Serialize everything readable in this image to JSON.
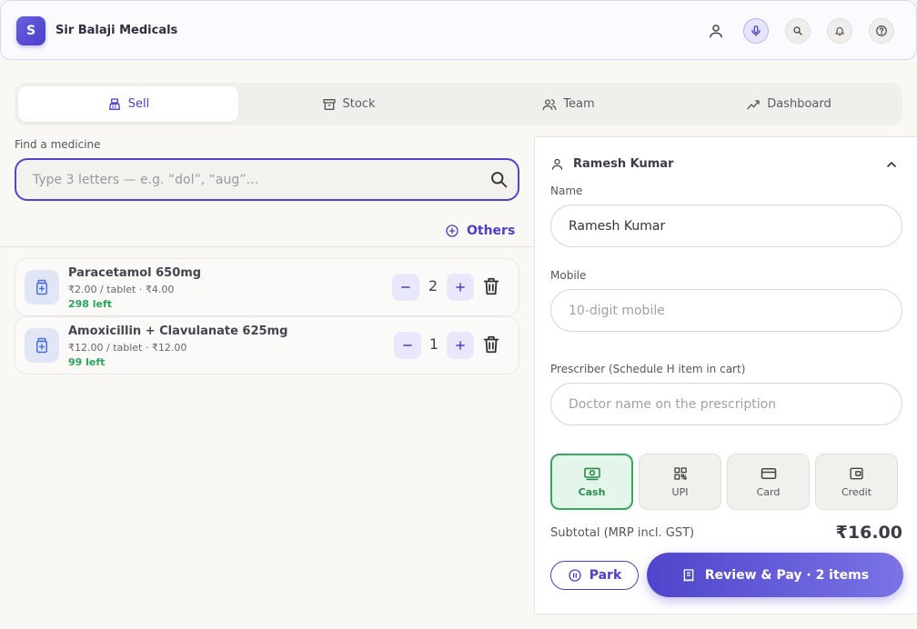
{
  "app": {
    "logo_letter": "S",
    "title": "Sir Balaji Medicals"
  },
  "header": {
    "icons": [
      "user-icon",
      "mic-icon",
      "search-icon",
      "bell-icon",
      "help-icon"
    ]
  },
  "tabs": [
    {
      "label": "Sell",
      "icon": "pos-icon",
      "active": true
    },
    {
      "label": "Stock",
      "icon": "box-icon",
      "active": false
    },
    {
      "label": "Team",
      "icon": "users-icon",
      "active": false
    },
    {
      "label": "Dashboard",
      "icon": "trend-icon",
      "active": false
    }
  ],
  "search": {
    "label": "Find a medicine",
    "placeholder": "Type 3 letters — e.g. “dol”, “aug”…",
    "value": ""
  },
  "others_label": "Others",
  "cart": [
    {
      "name": "Paracetamol 650mg",
      "price_line": "₹2.00 / tablet · ₹4.00",
      "stock": "298 left",
      "qty": "2"
    },
    {
      "name": "Amoxicillin + Clavulanate 625mg",
      "price_line": "₹12.00 / tablet · ₹12.00",
      "stock": "99 left",
      "qty": "1"
    }
  ],
  "customer": {
    "header_name": "Ramesh Kumar",
    "name_label": "Name",
    "name_value": "Ramesh Kumar",
    "mobile_label": "Mobile",
    "mobile_placeholder": "10-digit mobile",
    "prescriber_label": "Prescriber (Schedule H item in cart)",
    "prescriber_placeholder": "Doctor name on the prescription"
  },
  "payment_methods": [
    {
      "label": "Cash",
      "icon": "cash-icon",
      "selected": true
    },
    {
      "label": "UPI",
      "icon": "qr-icon",
      "selected": false
    },
    {
      "label": "Card",
      "icon": "card-icon",
      "selected": false
    },
    {
      "label": "Credit",
      "icon": "wallet-icon",
      "selected": false
    }
  ],
  "summary": {
    "subtotal_label": "Subtotal (MRP incl. GST)",
    "subtotal_value": "₹16.00"
  },
  "actions": {
    "park_label": "Park",
    "review_label": "Review & Pay · 2 items"
  },
  "colors": {
    "accent": "#4b40c8",
    "success": "#2aa55a",
    "background": "#faf8f5"
  }
}
